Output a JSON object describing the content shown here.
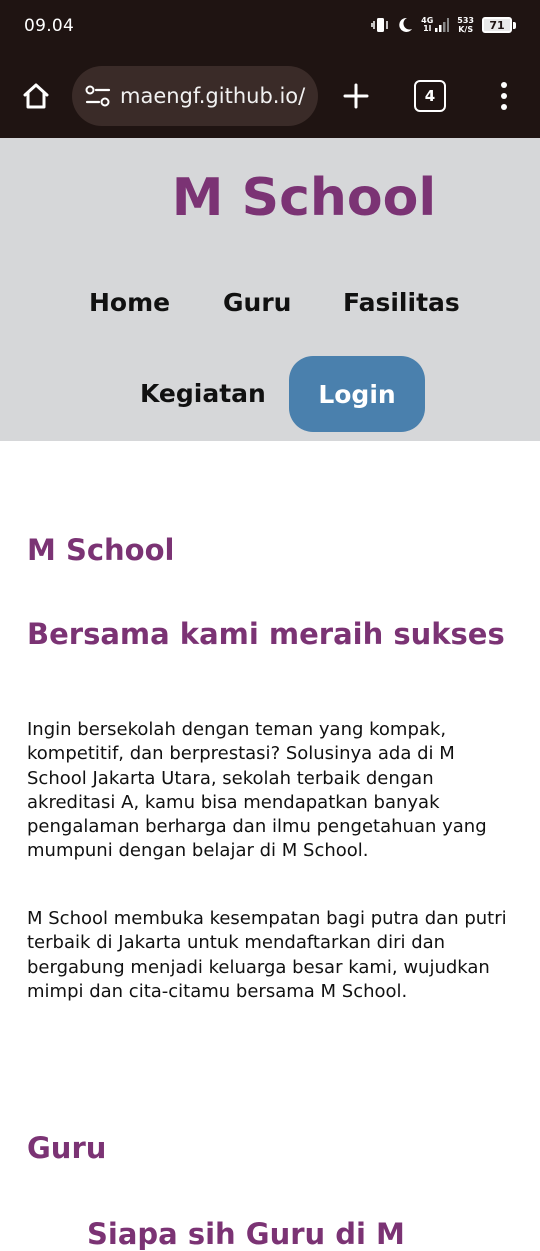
{
  "status_bar": {
    "time": "09.04",
    "network_label_top": "4G",
    "network_label_bottom": "1l",
    "speed_value": "533",
    "speed_unit": "K/S",
    "battery": "71",
    "icons": [
      "vibrate-icon",
      "moon-icon",
      "signal-icon",
      "battery-icon"
    ]
  },
  "browser": {
    "url": "maengf.github.io/",
    "tab_count": "4",
    "icons": [
      "home-icon",
      "site-settings-icon",
      "plus-icon",
      "tabs-icon",
      "more-icon"
    ]
  },
  "site": {
    "title": "M School",
    "nav": {
      "home": "Home",
      "guru": "Guru",
      "fasilitas": "Fasilitas",
      "kegiatan": "Kegiatan",
      "login": "Login"
    }
  },
  "main": {
    "heading": "M School",
    "tagline": "Bersama kami meraih sukses",
    "paragraph_1": "Ingin bersekolah dengan teman yang kompak, kompetitif, dan berprestasi? Solusinya ada di M School Jakarta Utara, sekolah terbaik dengan akreditasi A, kamu bisa mendapatkan banyak pengalaman berharga dan ilmu pengetahuan yang mumpuni dengan belajar di M School.",
    "paragraph_2": "M School membuka kesempatan bagi putra dan putri terbaik di Jakarta untuk mendaftarkan diri dan bergabung menjadi keluarga besar kami, wujudkan mimpi dan cita-citamu bersama M School.",
    "guru_heading": "Guru",
    "guru_subheading": "Siapa sih Guru di M"
  },
  "colors": {
    "brand": "#7b3374",
    "login_button": "#4a80ad",
    "header_bg": "#d6d7d9",
    "chrome_bg": "#1f1412"
  }
}
